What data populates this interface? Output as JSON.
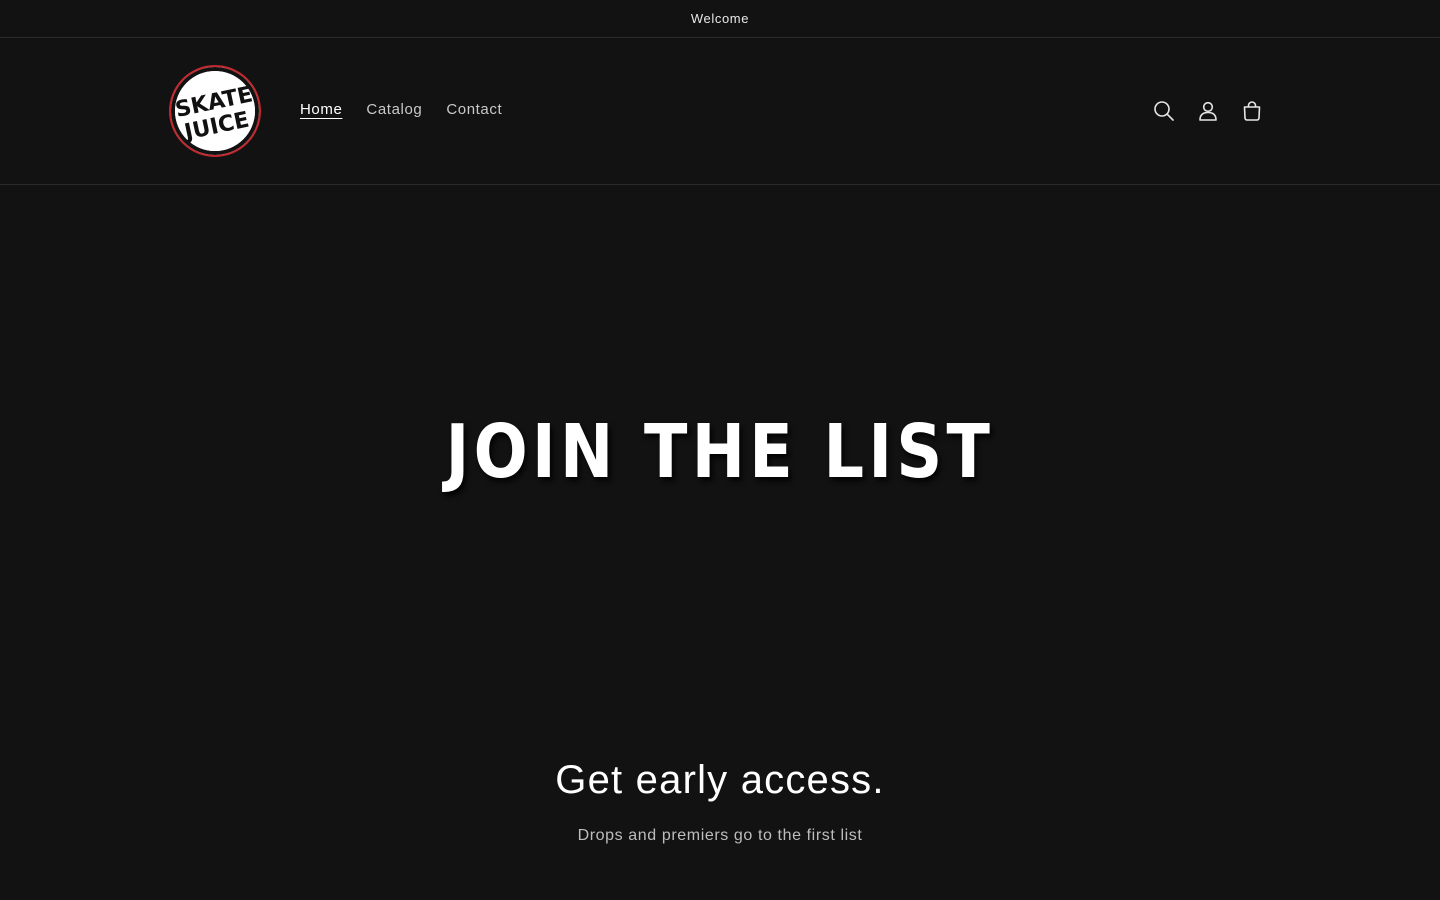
{
  "announcement": {
    "text": "Welcome"
  },
  "header": {
    "logo_text_line1": "SKATE",
    "logo_text_line2": "JUICE",
    "nav": [
      {
        "label": "Home",
        "active": true
      },
      {
        "label": "Catalog",
        "active": false
      },
      {
        "label": "Contact",
        "active": false
      }
    ],
    "icons": [
      "search-icon",
      "account-icon",
      "cart-icon"
    ]
  },
  "hero": {
    "title": "JOIN THE LIST"
  },
  "signup": {
    "heading": "Get early access.",
    "subtext": "Drops and premiers go to the first list"
  },
  "colors": {
    "background": "#121212",
    "text": "#ffffff",
    "muted_text": "#bdbdbd",
    "logo_ring": "#c0292f"
  }
}
